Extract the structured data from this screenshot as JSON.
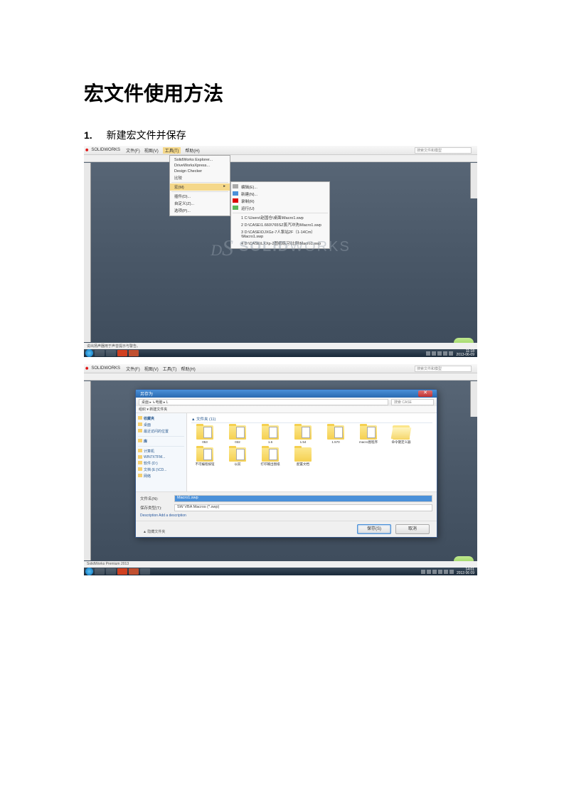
{
  "doc_title": "宏文件使用方法",
  "step1": "新建宏文件并保存",
  "screenshot1": {
    "app_name": "SOLIDWORKS",
    "menus": [
      "文件(F)",
      "视图(V)",
      "工具(T)",
      "帮助(H)"
    ],
    "search_placeholder": "搜索文件和模型",
    "dropdown_tools": {
      "items": [
        "SolidWorks Explorer...",
        "DriveWorksXpress...",
        "Design Checker",
        "比较"
      ],
      "highlighted": "宏(M)",
      "items_after": [
        "插件(D)...",
        "自定义(Z)...",
        "选项(P)..."
      ]
    },
    "dropdown_macro": {
      "actions": [
        "编辑(E)...",
        "新建(N)...",
        "录制(R)",
        "运行(U)"
      ],
      "recent": [
        "1  C:\\Users\\赵国仓\\桌面\\Macro1.swp",
        "2  D:\\CASE\\1.660\\765SZ蒸汽冲洗\\Macro1.swp",
        "3  D:\\CASE\\DJXGz-7人泵站2F（1-14Cm）\\Macro1.swp",
        "4  D:\\CASE\\LXXp-2图纸练习\\比例\\Macro1.swp"
      ]
    },
    "watermark_ds": "DS",
    "watermark_solid": "SOLID",
    "watermark_works": "WORKS",
    "statusbar_text": "说出扬声器用于声音提示与警告。",
    "taskbar_time": "11:18",
    "taskbar_date": "2013-06-09"
  },
  "screenshot2": {
    "dialog_title": "另存为",
    "nav_path": "桌面 ▸ ↳电脑 ▸ L",
    "nav_search": "搜索 CASE",
    "toolbar_text": "组织 ▾    新建文件夹",
    "sidebar": {
      "group1": [
        "桌面",
        "最近访问的位置"
      ],
      "group1_header": "收藏夹",
      "group2_header": "库",
      "group3": [
        "计算机",
        "WIN7XTFM...",
        "软件 (D:)",
        "文档 (E:)\\CD...",
        "网络"
      ]
    },
    "section_header": "▲ 文件夹 (11)",
    "folders_row1": [
      "053",
      "032",
      "1.6",
      "1.54",
      "1.570",
      "macro图程序",
      "命令键定义器"
    ],
    "folders_row2": [
      "不可编程按钮",
      "以前",
      "打印输出图纸",
      "配置文档"
    ],
    "field_filename_label": "文件名(N):",
    "field_filename_value": "Macro1.swp",
    "field_type_label": "保存类型(T):",
    "field_type_value": "SW VBA Macros (*.swp)",
    "desc_link": "Description  Add a description",
    "btn_save": "保存(S)",
    "btn_cancel": "取消",
    "footer_check": "隐藏文件夹",
    "taskbar_time": "14:01",
    "taskbar_date": "2013 06 09"
  }
}
